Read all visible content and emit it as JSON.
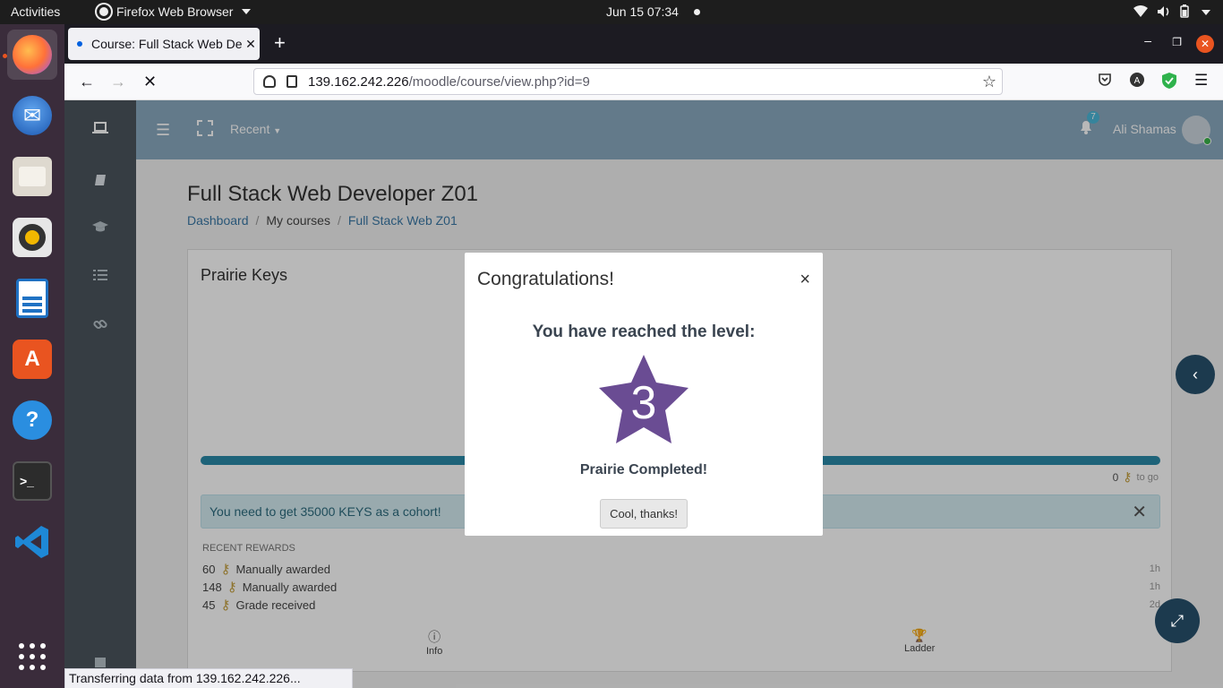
{
  "topbar": {
    "activities": "Activities",
    "app_name": "Firefox Web Browser",
    "clock": "Jun 15  07:34"
  },
  "dock": {
    "items": [
      {
        "name": "Firefox",
        "icon": "firefox-icon",
        "color": "#e66000"
      },
      {
        "name": "Thunderbird",
        "icon": "thunderbird-icon",
        "color": "#1a6fc9"
      },
      {
        "name": "Files",
        "icon": "files-icon",
        "color": "#d9d3c8"
      },
      {
        "name": "Rhythmbox",
        "icon": "rhythmbox-icon",
        "color": "#f1c40f"
      },
      {
        "name": "LibreOffice Writer",
        "icon": "writer-icon",
        "color": "#1f72c4"
      },
      {
        "name": "Ubuntu Software",
        "icon": "software-icon",
        "color": "#e95420"
      },
      {
        "name": "Help",
        "icon": "help-icon",
        "color": "#2a8ee0"
      },
      {
        "name": "Terminal",
        "icon": "terminal-icon",
        "color": "#2c2c2c"
      },
      {
        "name": "Visual Studio Code",
        "icon": "vscode-icon",
        "color": "#1e88d6"
      }
    ]
  },
  "browser": {
    "tab_title": "Course: Full Stack Web De",
    "url_host": "139.162.242.226",
    "url_path": "/moodle/course/view.php?id=9",
    "status": "Transferring data from 139.162.242.226..."
  },
  "moodle": {
    "header": {
      "recent": "Recent",
      "notif_count": "7",
      "username": "Ali Shamas"
    },
    "course_title": "Full Stack Web Developer Z01",
    "breadcrumb": {
      "dashboard": "Dashboard",
      "my_courses": "My courses",
      "course": "Full Stack Web Z01"
    },
    "card": {
      "title": "Prairie Keys",
      "togo_value": "0",
      "togo_label": "to go",
      "progress_fraction": 1.0,
      "alert": "You need to get 35000 KEYS as a cohort!",
      "rewards_heading": "RECENT REWARDS",
      "rewards": [
        {
          "points": "60",
          "label": "Manually awarded",
          "time": "1h"
        },
        {
          "points": "148",
          "label": "Manually awarded",
          "time": "1h"
        },
        {
          "points": "45",
          "label": "Grade received",
          "time": "2d"
        }
      ],
      "nav_info": "Info",
      "nav_ladder": "Ladder"
    }
  },
  "modal": {
    "title": "Congratulations!",
    "reached": "You have reached the level:",
    "level": "3",
    "level_name": "Prairie Completed!",
    "button": "Cool, thanks!",
    "star_color": "#6a4c93"
  }
}
